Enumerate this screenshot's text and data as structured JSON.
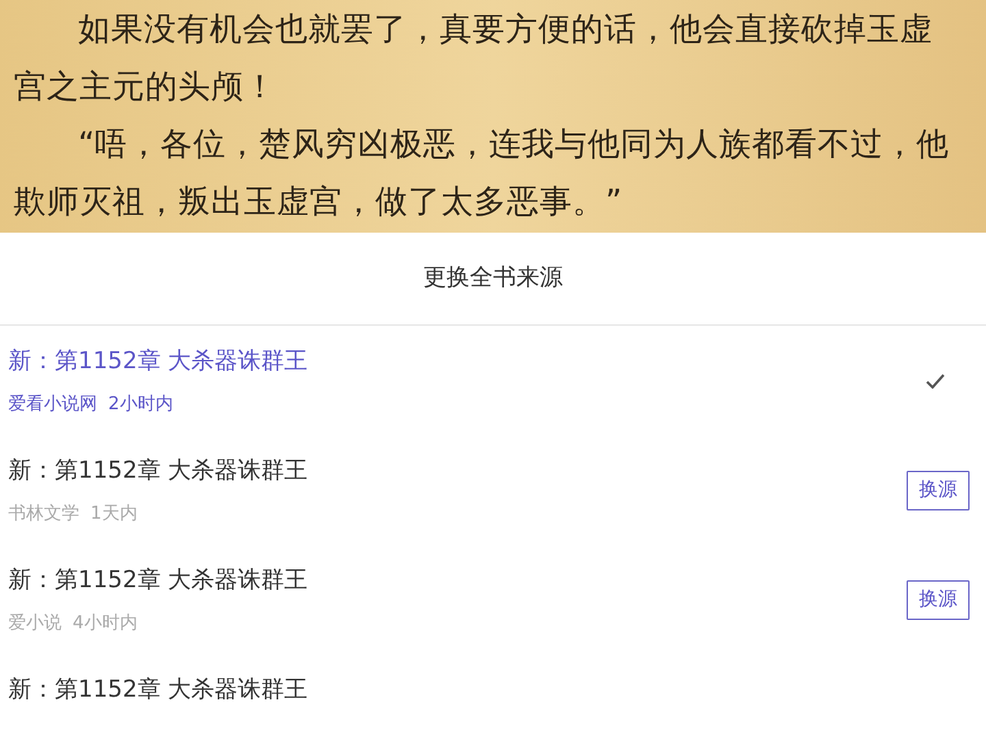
{
  "reader": {
    "paragraphs": [
      "如果没有机会也就罢了，真要方便的话，他会直接砍掉玉虚宫之主元的头颅！",
      "“唔，各位，楚风穷凶极恶，连我与他同为人族都看不过，他欺师灭祖，叛出玉虚宫，做了太多恶事。”"
    ]
  },
  "sheet": {
    "title": "更换全书来源",
    "sources": [
      {
        "chapter": "新：第1152章 大杀器诛群王",
        "source": "爱看小说网",
        "updated": "2小时内",
        "selected": true
      },
      {
        "chapter": "新：第1152章 大杀器诛群王",
        "source": "书林文学",
        "updated": "1天内",
        "selected": false,
        "button": "换源"
      },
      {
        "chapter": "新：第1152章 大杀器诛群王",
        "source": "爱小说",
        "updated": "4小时内",
        "selected": false,
        "button": "换源"
      },
      {
        "chapter": "新：第1152章 大杀器诛群王",
        "selected": false
      }
    ]
  }
}
